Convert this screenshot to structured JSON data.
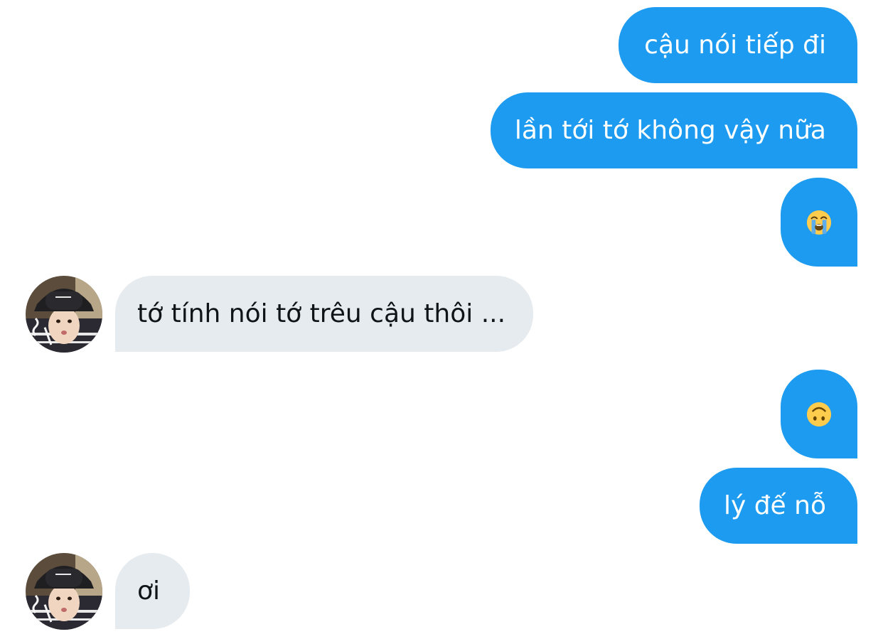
{
  "conversation": {
    "messages": [
      {
        "sender": "me",
        "type": "text",
        "text": "cậu nói tiếp đi"
      },
      {
        "sender": "me",
        "type": "text",
        "text": "lần tới tớ không vậy nữa"
      },
      {
        "sender": "me",
        "type": "emoji",
        "emoji": "loudly-crying-face"
      },
      {
        "sender": "other",
        "type": "text",
        "text": "tớ tính nói tớ trêu cậu thôi ..."
      },
      {
        "sender": "me",
        "type": "emoji",
        "emoji": "upside-down-face"
      },
      {
        "sender": "me",
        "type": "text",
        "text": "lý đế nỗ"
      },
      {
        "sender": "other",
        "type": "text",
        "text": "ơi"
      }
    ]
  },
  "colors": {
    "sent_bubble": "#1d9bf0",
    "received_bubble": "#e6ebef",
    "sent_text": "#ffffff",
    "received_text": "#0f1419"
  }
}
